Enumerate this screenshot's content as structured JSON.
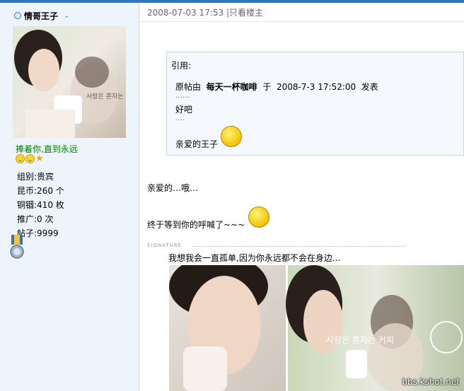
{
  "user": {
    "name": "情哥王子",
    "signature": "捧着你,直到永远",
    "stats": [
      "组别:贵宾",
      "昆币:260 个",
      "铜锢:410 枚",
      "推广:0 次",
      "帖子:9999"
    ]
  },
  "post": {
    "timestamp": "2008-07-03 17:53",
    "only_author_link": "|只看楼主",
    "quote": {
      "label": "引用:",
      "prefix": "原帖由",
      "author": "每天一杯咖啡",
      "mid": "于",
      "time": "2008-7-3 17:52:00",
      "suffix": "发表",
      "dots": "……",
      "line1": "好吧",
      "dots2": "….",
      "line2": "亲爱的王子"
    },
    "body_line1": "亲爱的…哦…",
    "body_line2": "终于等到你的呼喊了~~~"
  },
  "signature_block": {
    "label": "SIGNATURE",
    "text": "我想我会一直孤单,因为你永远都不会在身边..."
  },
  "avatar_caption": "사랑은 혼자는 커피",
  "photo_caption": "사랑은 혼자는 커피",
  "watermark": "bbs.kshot.net",
  "colors": {
    "accent": "#2a78c4",
    "sidebar_bg": "#eef4fc",
    "signature_green": "#008000"
  }
}
